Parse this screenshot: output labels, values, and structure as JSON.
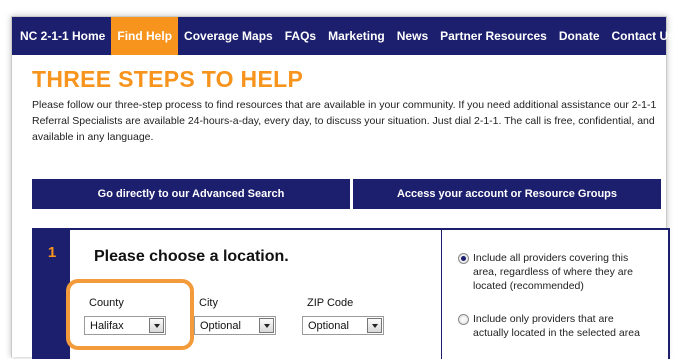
{
  "nav": {
    "items": [
      {
        "label": "NC 2-1-1 Home",
        "active": false
      },
      {
        "label": "Find Help",
        "active": true
      },
      {
        "label": "Coverage Maps",
        "active": false
      },
      {
        "label": "FAQs",
        "active": false
      },
      {
        "label": "Marketing",
        "active": false
      },
      {
        "label": "News",
        "active": false
      },
      {
        "label": "Partner Resources",
        "active": false
      },
      {
        "label": "Donate",
        "active": false
      },
      {
        "label": "Contact Us",
        "active": false
      }
    ]
  },
  "page": {
    "heading": "THREE STEPS TO HELP",
    "intro": "Please follow our three-step process to find resources that are available in your community. If you need additional assistance our 2-1-1 Referral Specialists are available 24-hours-a-day, every day, to discuss your situation. Just dial 2-1-1. The call is free, confidential, and available in any language."
  },
  "buttons": {
    "advanced_search": "Go directly to our Advanced Search",
    "account": "Access your account or Resource Groups"
  },
  "step1": {
    "number": "1",
    "title": "Please choose a location.",
    "county": {
      "label": "County",
      "value": "Halifax"
    },
    "city": {
      "label": "City",
      "value": "Optional"
    },
    "zip": {
      "label": "ZIP Code",
      "value": "Optional"
    },
    "options": [
      {
        "label": "Include all providers covering this area, regardless of where they are located (recommended)",
        "selected": true
      },
      {
        "label": "Include only providers that are actually located in the selected area",
        "selected": false
      }
    ]
  },
  "colors": {
    "nav_bg": "#1c1f6e",
    "accent": "#f7941d",
    "highlight": "#f39b3a"
  }
}
